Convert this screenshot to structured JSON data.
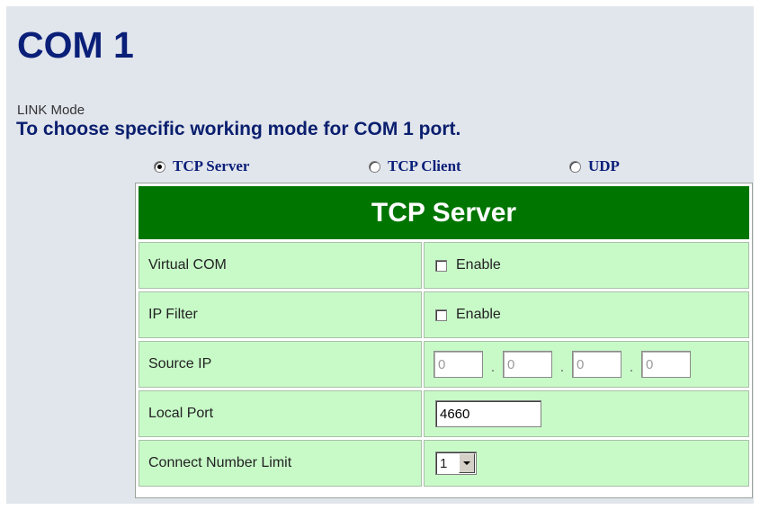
{
  "page": {
    "title": "COM 1"
  },
  "section": {
    "label": "LINK Mode",
    "description": "To choose specific working mode for COM 1 port."
  },
  "link_mode": {
    "options": [
      {
        "label": "TCP Server",
        "checked": true
      },
      {
        "label": "TCP Client",
        "checked": false
      },
      {
        "label": "UDP",
        "checked": false
      }
    ]
  },
  "table": {
    "header": "TCP Server",
    "rows": {
      "virtual_com": {
        "label": "Virtual COM",
        "option": "Enable",
        "checked": false
      },
      "ip_filter": {
        "label": "IP Filter",
        "option": "Enable",
        "checked": false
      },
      "source_ip": {
        "label": "Source IP",
        "octets": [
          "0",
          "0",
          "0",
          "0"
        ],
        "separator": "."
      },
      "local_port": {
        "label": "Local Port",
        "value": "4660"
      },
      "connect_limit": {
        "label": "Connect Number Limit",
        "selected": "1"
      }
    }
  },
  "colors": {
    "title": "#0a1f78",
    "header_bg": "#007500",
    "cell_bg": "#c8fac8",
    "page_bg": "#e1e5ec"
  }
}
